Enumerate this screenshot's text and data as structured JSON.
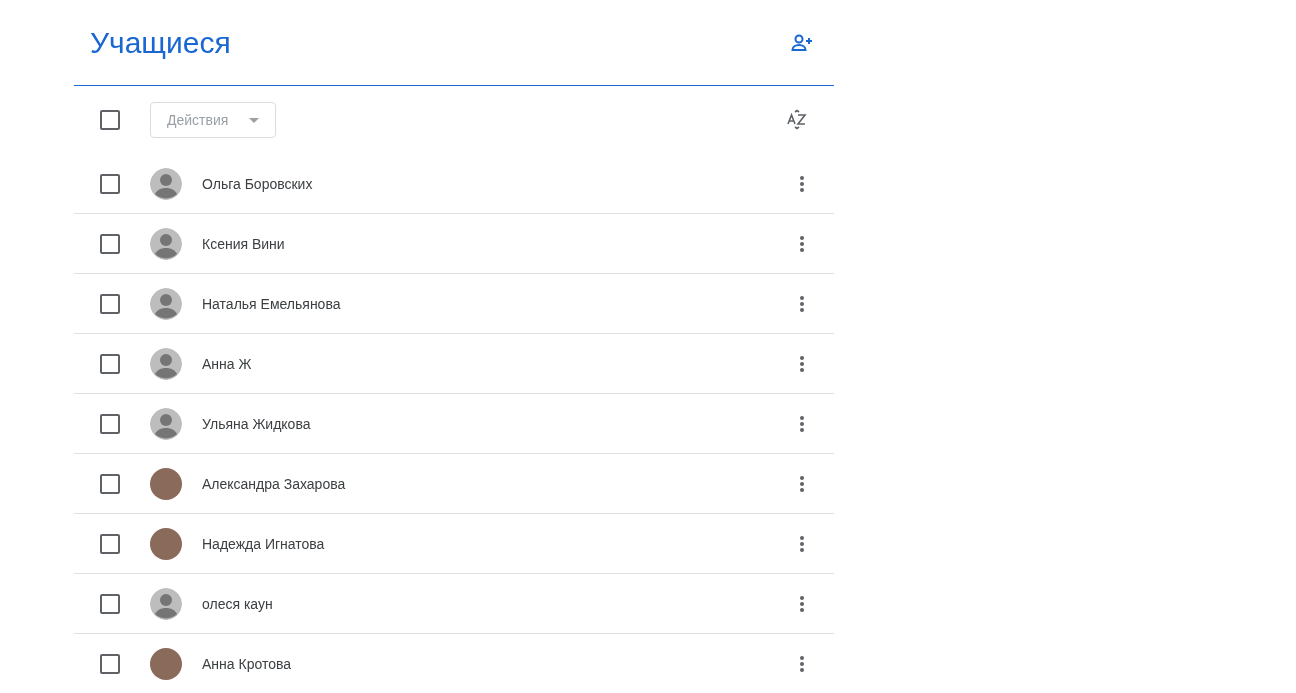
{
  "header": {
    "title": "Учащиеся"
  },
  "toolbar": {
    "select_all": {
      "checked": false
    },
    "actions": {
      "label": "Действия",
      "disabled": true
    }
  },
  "students": [
    {
      "name": "Ольга Боровских",
      "checked": false,
      "kind": "default"
    },
    {
      "name": "Ксения Вини",
      "checked": false,
      "kind": "default"
    },
    {
      "name": "Наталья Емельянова",
      "checked": false,
      "kind": "default"
    },
    {
      "name": "Анна Ж",
      "checked": false,
      "kind": "default"
    },
    {
      "name": "Ульяна Жидкова",
      "checked": false,
      "kind": "default"
    },
    {
      "name": "Александра Захарова",
      "checked": false,
      "kind": "photo"
    },
    {
      "name": "Надежда Игнатова",
      "checked": false,
      "kind": "photo"
    },
    {
      "name": "олеся каун",
      "checked": false,
      "kind": "default"
    },
    {
      "name": "Анна Кротова",
      "checked": false,
      "kind": "photo"
    }
  ]
}
